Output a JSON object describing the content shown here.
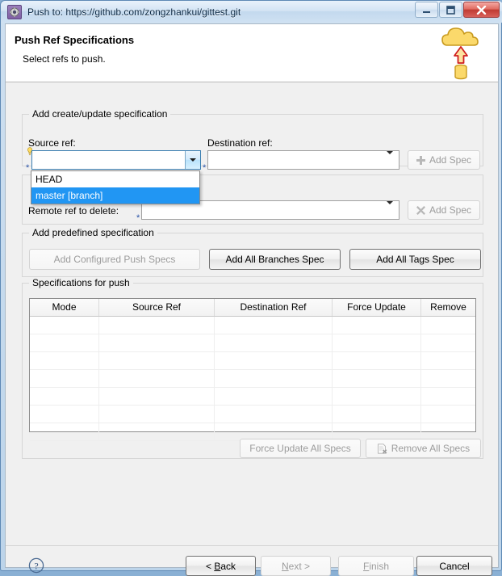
{
  "window": {
    "title": "Push to: https://github.com/zongzhankui/gittest.git",
    "app_icon": "gear-icon",
    "controls": {
      "minimize": "minimize",
      "maximize": "maximize",
      "close": "close"
    }
  },
  "header": {
    "title": "Push Ref Specifications",
    "subtitle": "Select refs to push.",
    "banner_icon": "cloud-push-icon"
  },
  "create_group": {
    "legend": "Add create/update specification",
    "source_label": "Source ref:",
    "destination_label": "Destination ref:",
    "source_value": "",
    "destination_value": "",
    "add_spec_label": "Add Spec",
    "add_spec_icon": "plus-icon"
  },
  "dropdown": {
    "open": true,
    "items": [
      {
        "label": "HEAD",
        "selected": false
      },
      {
        "label": "master [branch]",
        "selected": true
      }
    ],
    "highlight_color": "#2196f3"
  },
  "delete_group": {
    "legend": "",
    "remote_label": "Remote ref to delete:",
    "remote_value": "",
    "add_spec_label": "Add Spec",
    "add_spec_icon": "cross-icon"
  },
  "predefined_group": {
    "legend": "Add predefined specification",
    "buttons": [
      {
        "label": "Add Configured Push Specs",
        "enabled": false
      },
      {
        "label": "Add All Branches Spec",
        "enabled": true
      },
      {
        "label": "Add All Tags Spec",
        "enabled": true
      }
    ]
  },
  "specs_group": {
    "legend": "Specifications for push",
    "columns": [
      "Mode",
      "Source Ref",
      "Destination Ref",
      "Force Update",
      "Remove"
    ],
    "rows": [],
    "empty_row_count": 7,
    "actions": [
      {
        "label": "Force Update All Specs",
        "enabled": false,
        "icon": ""
      },
      {
        "label": "Remove All Specs",
        "enabled": false,
        "icon": "remove-doc-icon"
      }
    ]
  },
  "footer": {
    "help_icon": "help-icon",
    "buttons": [
      {
        "label": "< Back",
        "enabled": true,
        "mnemonic": "B"
      },
      {
        "label": "Next >",
        "enabled": false,
        "mnemonic": "N"
      },
      {
        "label": "Finish",
        "enabled": false,
        "mnemonic": "F"
      },
      {
        "label": "Cancel",
        "enabled": true,
        "mnemonic": ""
      }
    ]
  }
}
